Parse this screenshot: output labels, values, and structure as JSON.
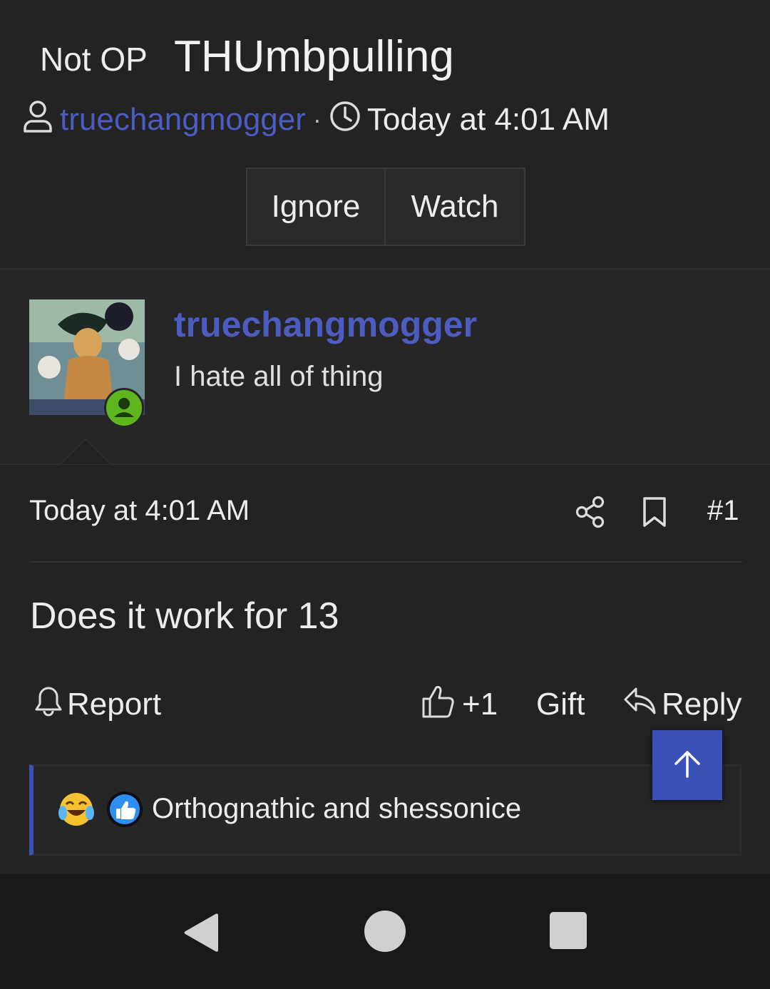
{
  "thread": {
    "prefix": "Not OP",
    "title": "THUmbpulling",
    "author": "truechangmogger",
    "separator": "·",
    "timestamp": "Today at 4:01 AM"
  },
  "thread_buttons": {
    "ignore": "Ignore",
    "watch": "Watch"
  },
  "user": {
    "name": "truechangmogger",
    "title": "I hate all of thing",
    "online": true
  },
  "post": {
    "timestamp": "Today at 4:01 AM",
    "number": "#1",
    "body": "Does it work for 13"
  },
  "post_actions": {
    "report": "Report",
    "like": "+1",
    "gift": "Gift",
    "reply": "Reply"
  },
  "reactions": {
    "text": "Orthognathic and shessonice",
    "icons": [
      "laughing-crying-emoji",
      "thumbs-up-reaction"
    ]
  },
  "colors": {
    "accent": "#3b51b8",
    "link": "#4c5cc0",
    "online": "#5fb51e",
    "background": "#232323"
  },
  "icons": {
    "author": "user-icon",
    "time": "clock-icon",
    "share": "share-icon",
    "bookmark": "bookmark-icon",
    "report": "bell-icon",
    "like": "thumbs-up-icon",
    "reply": "reply-icon",
    "scroll_top": "arrow-up-icon",
    "nav_back": "back-triangle-icon",
    "nav_home": "home-circle-icon",
    "nav_recents": "recents-square-icon"
  }
}
